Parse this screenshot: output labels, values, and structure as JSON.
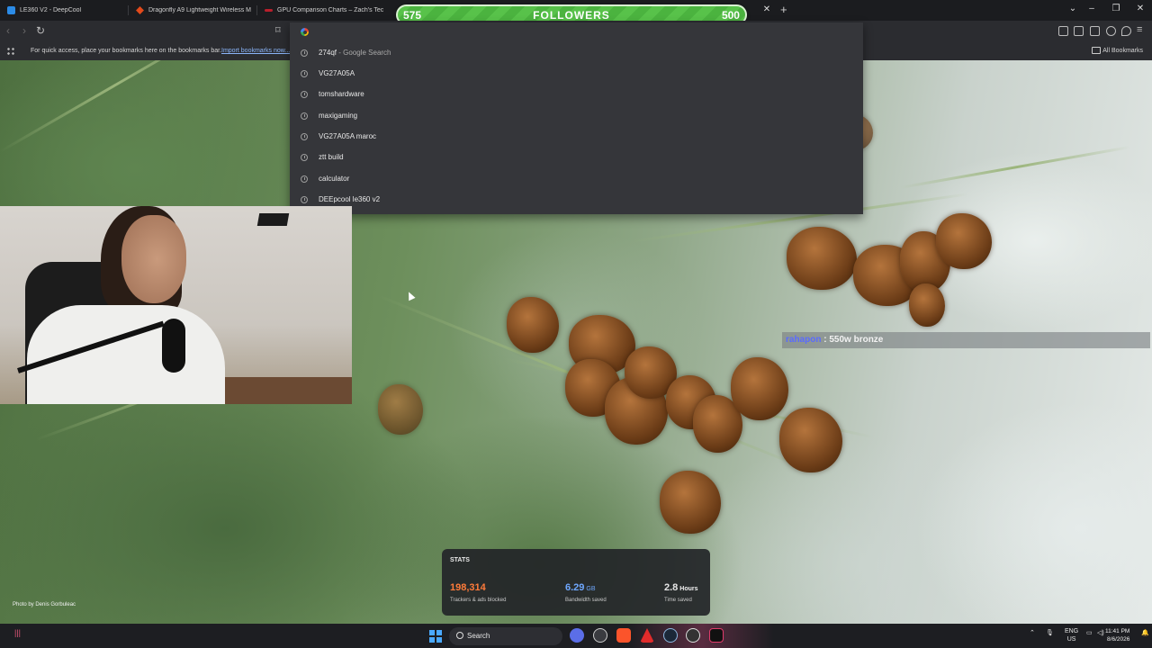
{
  "browser": {
    "tabs": [
      {
        "label": "LE360 V2 - DeepCool",
        "favicon_color": "#2b8be6"
      },
      {
        "label": "Dragonfly A9 Lightweight Wireless M",
        "favicon_color": "#e24a1b"
      },
      {
        "label": "GPU Comparison Charts – Zach's Tec",
        "favicon_color": "#b81f2c"
      }
    ],
    "tab_close": "✕",
    "tab_new": "+",
    "bookmarks_bar": {
      "hint": "For quick access, place your bookmarks here on the bookmarks bar.",
      "import_link": "Import bookmarks now...",
      "all_bookmarks": "All Bookmarks"
    },
    "omnibox": {
      "suggestions": [
        {
          "text": "274qf",
          "sub": " - Google Search"
        },
        {
          "text": "VG27A05A",
          "sub": ""
        },
        {
          "text": "tomshardware",
          "sub": ""
        },
        {
          "text": "maxigaming",
          "sub": ""
        },
        {
          "text": "VG27A05A maroc",
          "sub": ""
        },
        {
          "text": "ztt build",
          "sub": ""
        },
        {
          "text": "calculator",
          "sub": ""
        },
        {
          "text": "DEEpcool le360 v2",
          "sub": ""
        }
      ]
    }
  },
  "overlay": {
    "followers": {
      "current": "575",
      "title": "FOLLOWERS",
      "goal": "500",
      "progress_fraction": 1.0
    },
    "chat": {
      "user": "rahapon",
      "message": " : 550w bronze"
    },
    "photo_credit": "Photo by Denis Gorbuleac"
  },
  "stats": {
    "title": "STATS",
    "items": [
      {
        "value": "198,314",
        "unit": "",
        "label": "Trackers & ads blocked",
        "color": "#ff7b3a"
      },
      {
        "value": "6.29",
        "unit": "GB",
        "label": "Bandwidth saved",
        "color": "#6fa8ff"
      },
      {
        "value": "2.8",
        "unit": "Hours",
        "label": "Time saved",
        "color": "#f2f2f2"
      }
    ]
  },
  "taskbar": {
    "search_label": "Search",
    "language": "ENG",
    "region": "US",
    "time": "11:41 PM",
    "date": "8/6/2026"
  }
}
